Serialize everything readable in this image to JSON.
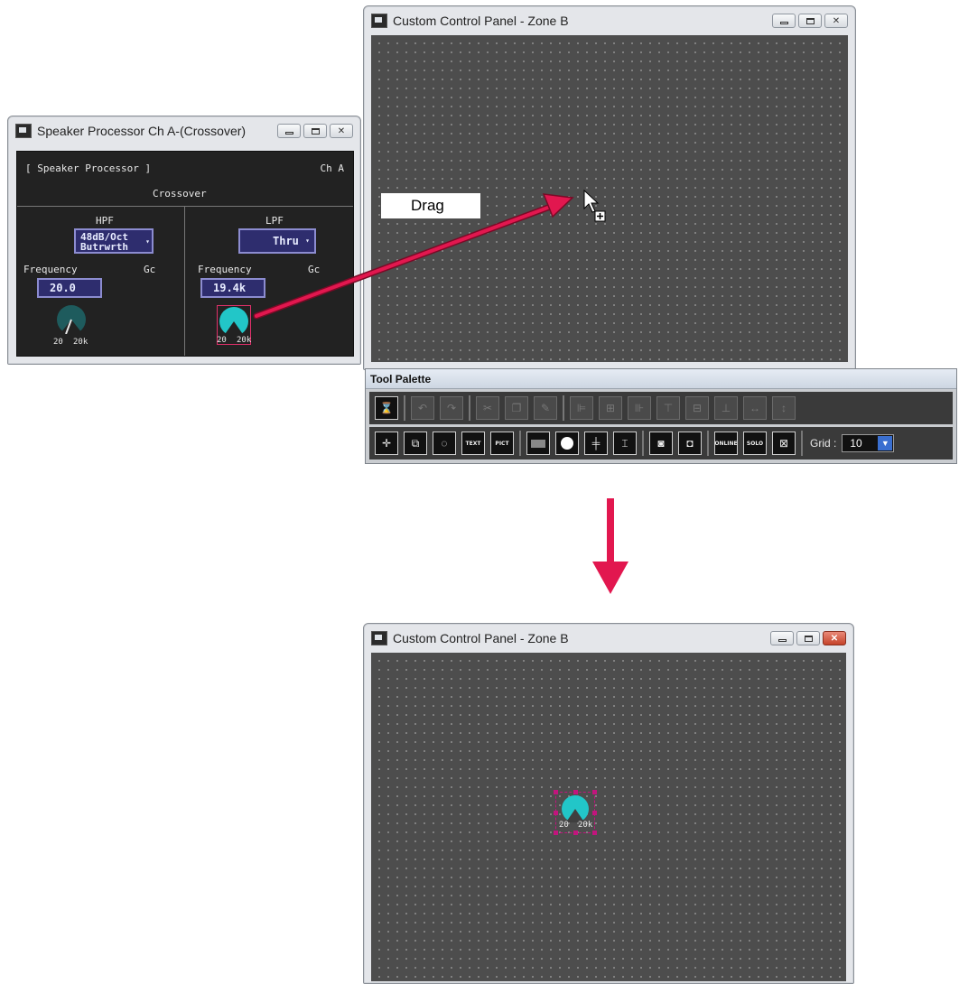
{
  "speaker_processor": {
    "title": "Speaker Processor  Ch A-(Crossover)",
    "header_left": "[ Speaker Processor ]",
    "header_right": "Ch  A",
    "section": "Crossover",
    "hpf": {
      "label": "HPF",
      "type_line1": "48dB/Oct",
      "type_line2": "Butrwrth",
      "freq_label": "Frequency",
      "gc": "Gc",
      "freq_value": "20.0",
      "knob_min": "20",
      "knob_max": "20k"
    },
    "lpf": {
      "label": "LPF",
      "type": "Thru",
      "freq_label": "Frequency",
      "gc": "Gc",
      "freq_value": "19.4k",
      "knob_min": "20",
      "knob_max": "20k"
    }
  },
  "custom_panel_top": {
    "title": "Custom Control Panel - Zone B"
  },
  "drag_label": "Drag",
  "tool_palette": {
    "title": "Tool Palette",
    "text_tool_tag": "TEXT",
    "pict_tool_tag": "PICT",
    "online_tag": "ONLINE",
    "solo_tag": "SOLO",
    "grid_label": "Grid :",
    "grid_value": "10"
  },
  "custom_panel_bottom": {
    "title": "Custom Control Panel - Zone B",
    "knob_min": "20",
    "knob_max": "20k"
  },
  "colors": {
    "accent_arrow": "#e2174f",
    "knob_teal": "#22c6c8",
    "selection": "#c2157d"
  }
}
